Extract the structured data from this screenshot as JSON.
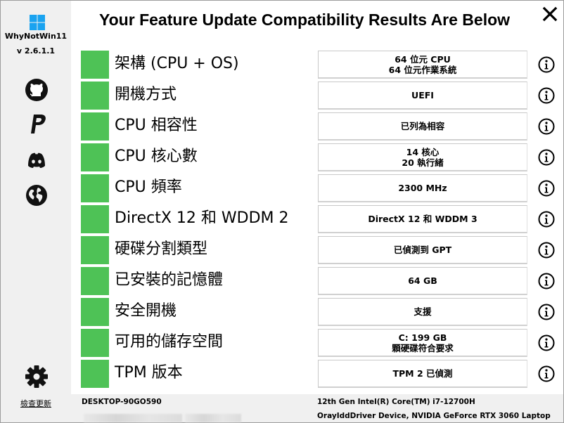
{
  "app": {
    "name": "WhyNotWin11",
    "version": "v 2.6.1.1"
  },
  "sidebar": {
    "icons": [
      "github-icon",
      "paypal-icon",
      "discord-icon",
      "globe-icon",
      "gear-icon"
    ],
    "update_link": "檢查更新"
  },
  "header": {
    "title": "Your Feature Update Compatibility Results Are Below",
    "close_glyph": "✕"
  },
  "checks": [
    {
      "label": "架構 (CPU + OS)",
      "result": [
        "64 位元 CPU",
        "64 位元作業系統"
      ],
      "status": "pass"
    },
    {
      "label": "開機方式",
      "result": [
        "UEFI"
      ],
      "status": "pass"
    },
    {
      "label": "CPU 相容性",
      "result": [
        "已列為相容"
      ],
      "status": "pass"
    },
    {
      "label": "CPU 核心數",
      "result": [
        "14 核心",
        "20 執行緒"
      ],
      "status": "pass"
    },
    {
      "label": "CPU 頻率",
      "result": [
        "2300 MHz"
      ],
      "status": "pass"
    },
    {
      "label": "DirectX 12 和 WDDM 2",
      "result": [
        "DirectX 12 和 WDDM 3"
      ],
      "status": "pass"
    },
    {
      "label": "硬碟分割類型",
      "result": [
        "已偵測到 GPT"
      ],
      "status": "pass"
    },
    {
      "label": "已安裝的記憶體",
      "result": [
        "64 GB"
      ],
      "status": "pass"
    },
    {
      "label": "安全開機",
      "result": [
        "支援"
      ],
      "status": "pass"
    },
    {
      "label": "可用的儲存空間",
      "result": [
        "C: 199 GB",
        "顆硬碟符合要求"
      ],
      "status": "pass"
    },
    {
      "label": "TPM 版本",
      "result": [
        "TPM 2 已偵測"
      ],
      "status": "pass"
    }
  ],
  "footer": {
    "hostname": "DESKTOP-90GO590",
    "cpu": "12th Gen Intel(R) Core(TM) i7-12700H",
    "gpu": "OrayIddDriver Device, NVIDIA GeForce RTX 3060 Laptop"
  },
  "colors": {
    "pass": "#4ec256",
    "sidebar_bg": "#f0f0f0"
  }
}
